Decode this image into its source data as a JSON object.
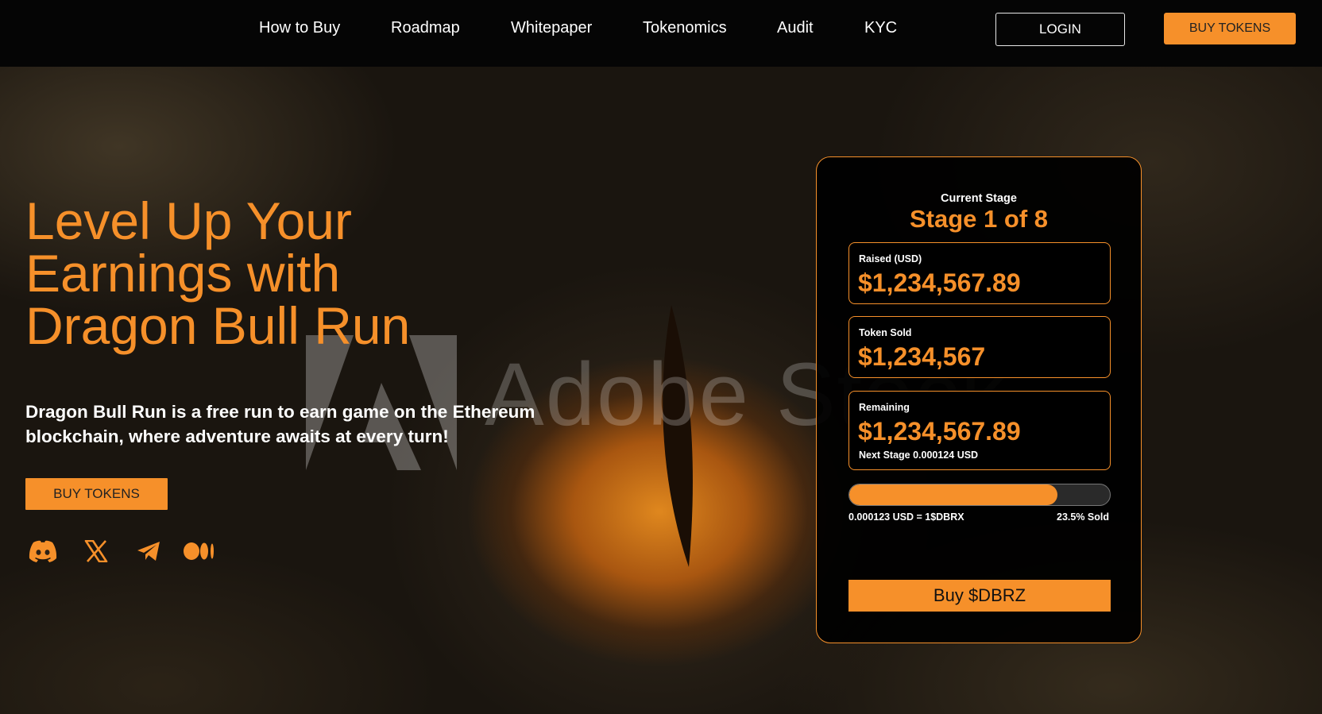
{
  "nav": {
    "links": [
      "How to Buy",
      "Roadmap",
      "Whitepaper",
      "Tokenomics",
      "Audit",
      "KYC"
    ],
    "login_label": "LOGIN",
    "buy_label": "BUY TOKENS"
  },
  "hero": {
    "title": "Level Up Your Earnings with Dragon Bull Run",
    "description": "Dragon Bull Run is a free run to earn game on the Ethereum blockchain, where adventure awaits at every turn!",
    "buy_label": "BUY TOKENS",
    "watermark": "Adobe Stock",
    "socials": [
      "discord-icon",
      "x-icon",
      "telegram-icon",
      "medium-icon"
    ]
  },
  "presale": {
    "stage_label": "Current Stage",
    "stage_value": "Stage 1 of 8",
    "raised_label": "Raised (USD)",
    "raised_value": "$1,234,567.89",
    "sold_label": "Token Sold",
    "sold_value": "$1,234,567",
    "remaining_label": "Remaining",
    "remaining_value": "$1,234,567.89",
    "next_stage": "Next Stage 0.000124 USD",
    "progress_fraction": 0.8,
    "rate": "0.000123 USD = 1$DBRX",
    "sold_percent": "23.5% Sold",
    "buy_label": "Buy $DBRZ"
  },
  "colors": {
    "accent": "#f6902a",
    "nav_bg": "#050505"
  }
}
